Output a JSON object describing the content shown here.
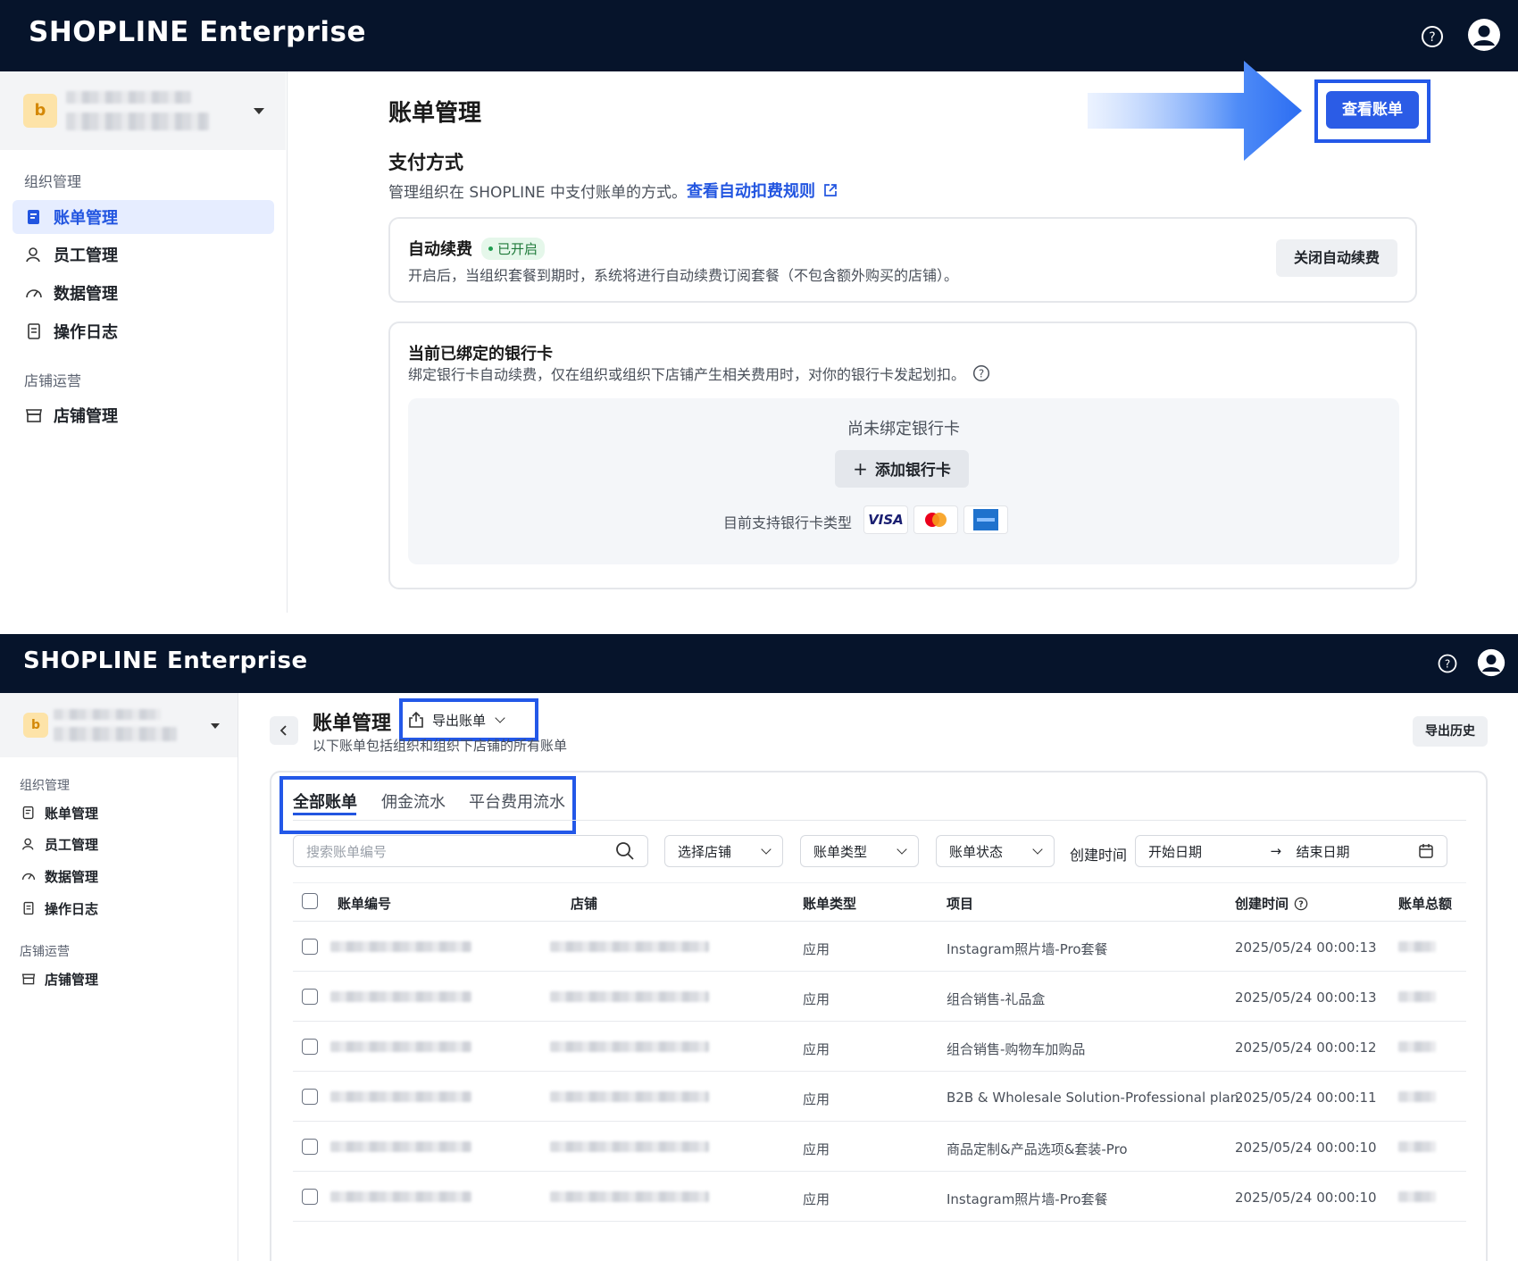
{
  "panel1": {
    "header": {
      "logo_brand": "SHOPLINE",
      "logo_suffix": "Enterprise"
    },
    "sidebar": {
      "store_avatar": "b",
      "groups": [
        {
          "title": "组织管理",
          "items": [
            "账单管理",
            "员工管理",
            "数据管理",
            "操作日志"
          ]
        },
        {
          "title": "店铺运营",
          "items": [
            "店铺管理"
          ]
        }
      ]
    },
    "page_title": "账单管理",
    "view_bills_button": "查看账单",
    "payment": {
      "title": "支付方式",
      "description": "管理组织在 SHOPLINE 中支付账单的方式。",
      "rules_link": "查看自动扣费规则"
    },
    "auto_renew": {
      "title": "自动续费",
      "status": "已开启",
      "description": "开启后，当组织套餐到期时，系统将进行自动续费订阅套餐（不包含额外购买的店铺）。",
      "button": "关闭自动续费"
    },
    "bank_card": {
      "title": "当前已绑定的银行卡",
      "description": "绑定银行卡自动续费，仅在组织或组织下店铺产生相关费用时，对你的银行卡发起划扣。",
      "empty_text": "尚未绑定银行卡",
      "add_button": "添加银行卡",
      "supported_label": "目前支持银行卡类型",
      "card_types": [
        "VISA",
        "mastercard",
        "amex"
      ]
    }
  },
  "panel2": {
    "header": {
      "logo_brand": "SHOPLINE",
      "logo_suffix": "Enterprise"
    },
    "sidebar": {
      "store_avatar": "b",
      "groups": [
        {
          "title": "组织管理",
          "items": [
            "账单管理",
            "员工管理",
            "数据管理",
            "操作日志"
          ]
        },
        {
          "title": "店铺运营",
          "items": [
            "店铺管理"
          ]
        }
      ]
    },
    "page_title": "账单管理",
    "export_button": "导出账单",
    "subtitle": "以下账单包括组织和组织下店铺的所有账单",
    "export_history_button": "导出历史",
    "tabs": [
      "全部账单",
      "佣金流水",
      "平台费用流水"
    ],
    "filters": {
      "search_placeholder": "搜索账单编号",
      "store_select": "选择店铺",
      "type_select": "账单类型",
      "status_select": "账单状态",
      "created_label": "创建时间",
      "start_date": "开始日期",
      "end_date": "结束日期"
    },
    "table": {
      "columns": [
        "账单编号",
        "店铺",
        "账单类型",
        "项目",
        "创建时间",
        "账单总额"
      ],
      "rows": [
        {
          "type": "应用",
          "item": "Instagram照片墙-Pro套餐",
          "created": "2025/05/24 00:00:13"
        },
        {
          "type": "应用",
          "item": "组合销售-礼品盒",
          "created": "2025/05/24 00:00:13"
        },
        {
          "type": "应用",
          "item": "组合销售-购物车加购品",
          "created": "2025/05/24 00:00:12"
        },
        {
          "type": "应用",
          "item": "B2B & Wholesale Solution-Professional plan",
          "created": "2025/05/24 00:00:11"
        },
        {
          "type": "应用",
          "item": "商品定制&产品选项&套装-Pro",
          "created": "2025/05/24 00:00:10"
        },
        {
          "type": "应用",
          "item": "Instagram照片墙-Pro套餐",
          "created": "2025/05/24 00:00:10"
        }
      ]
    }
  },
  "colors": {
    "header_bg": "#06142b",
    "accent": "#2b5ce6",
    "highlight_border": "#2358e8"
  },
  "icons": [
    "help-icon",
    "user-icon",
    "bill-icon",
    "employee-icon",
    "data-icon",
    "log-icon",
    "store-icon",
    "arrow-icon",
    "external-link-icon",
    "info-icon",
    "plus-icon",
    "export-icon",
    "search-icon",
    "calendar-icon",
    "back-icon"
  ]
}
